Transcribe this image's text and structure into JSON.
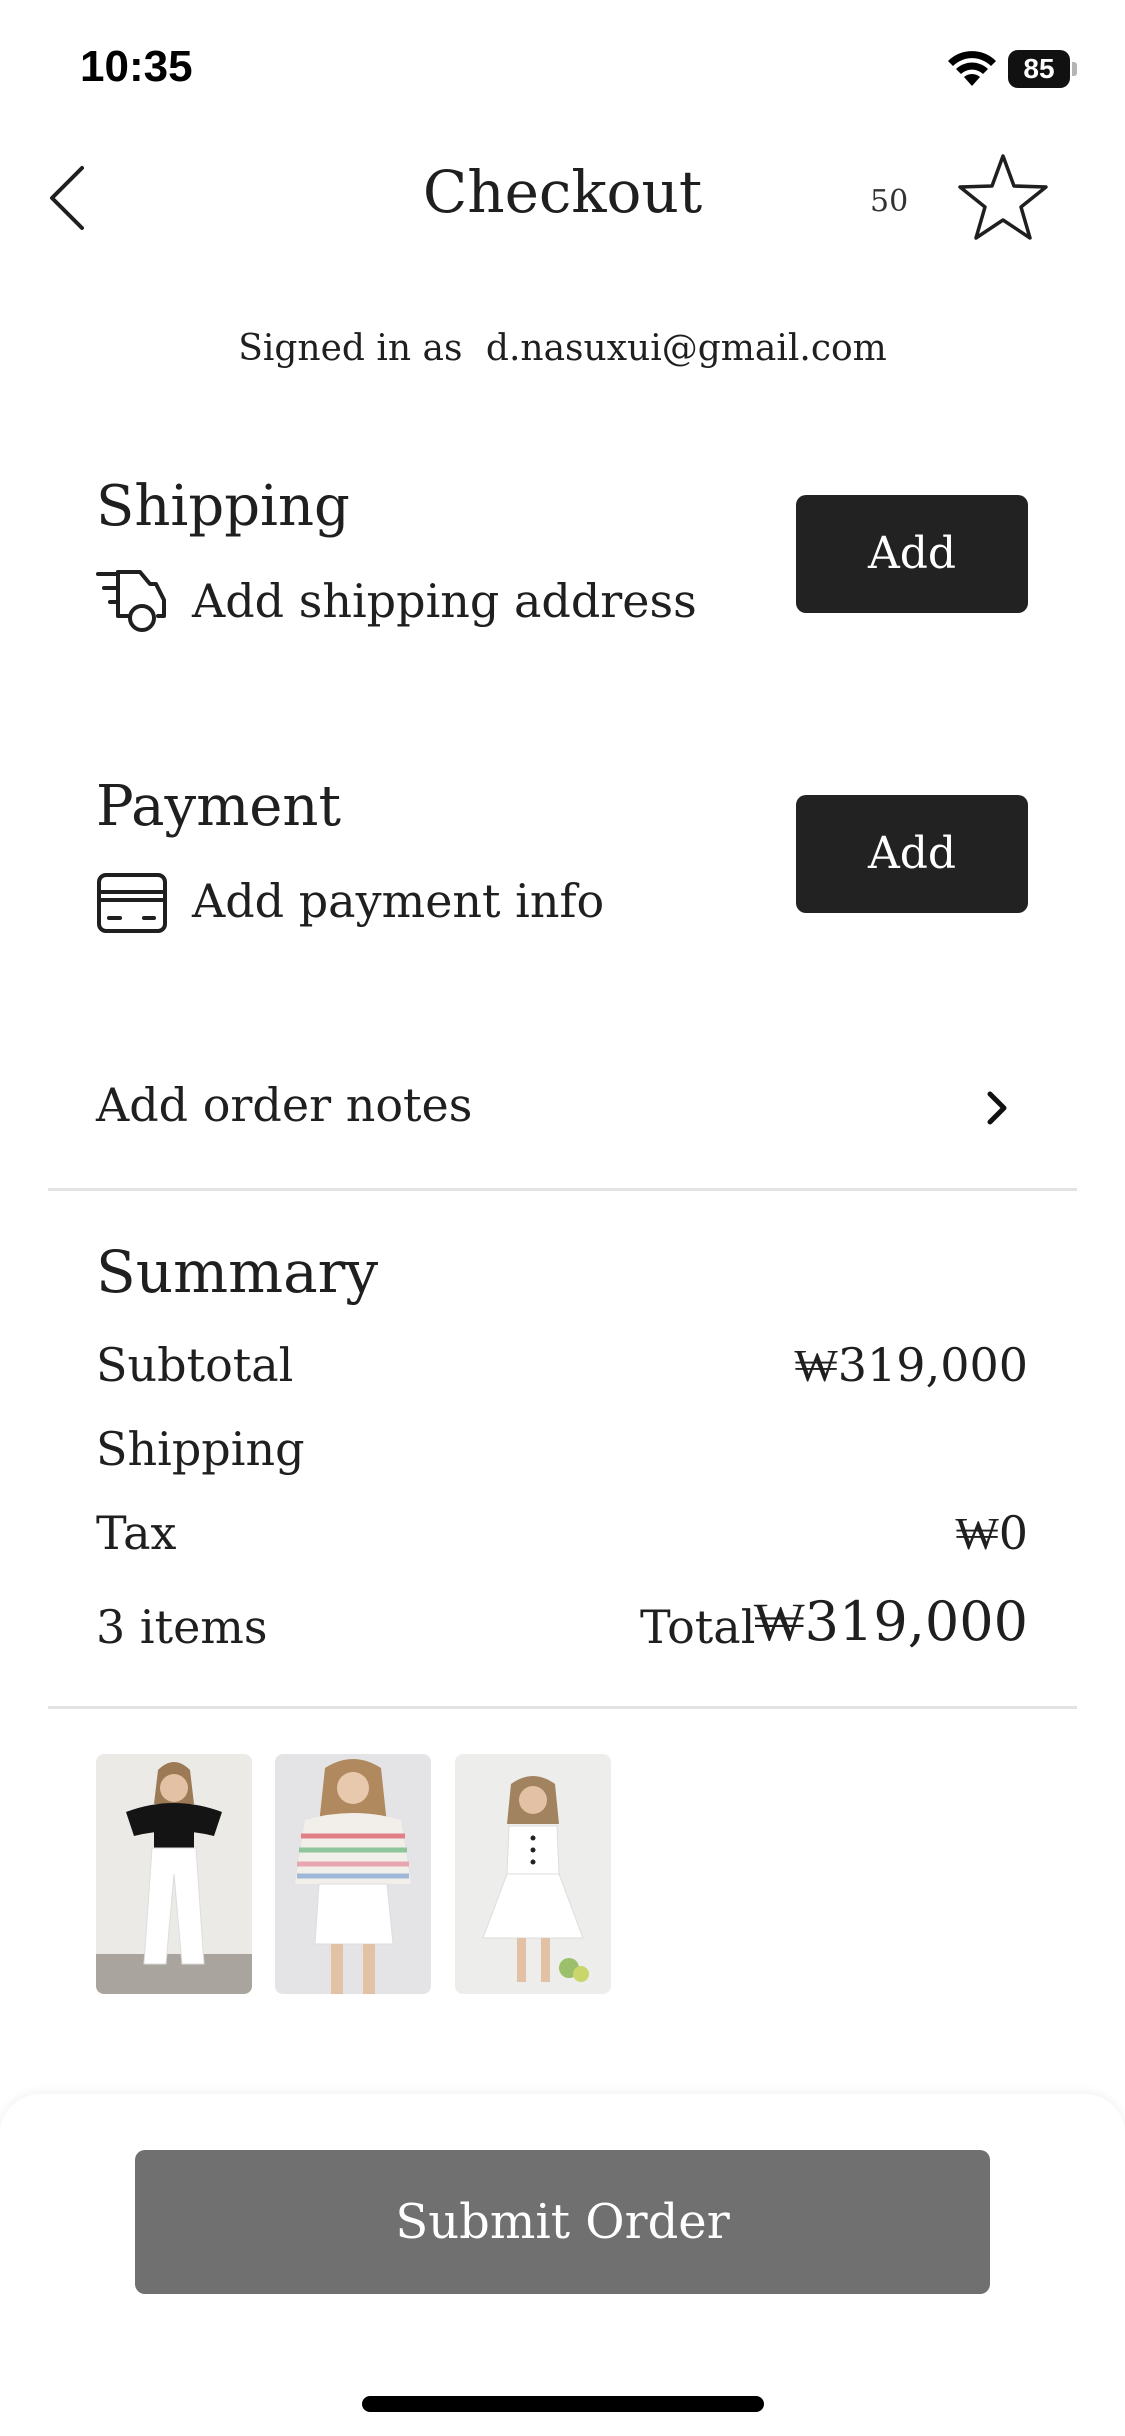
{
  "status_bar": {
    "time": "10:35",
    "battery": "85"
  },
  "header": {
    "title": "Checkout",
    "favorites_count": "50"
  },
  "account": {
    "signed_in_label": "Signed in as",
    "email": "d.nasuxui@gmail.com"
  },
  "shipping": {
    "title": "Shipping",
    "subtitle": "Add shipping address",
    "button_label": "Add",
    "icon": "delivery-truck-icon"
  },
  "payment": {
    "title": "Payment",
    "subtitle": "Add payment info",
    "button_label": "Add",
    "icon": "credit-card-icon"
  },
  "order_notes": {
    "label": "Add order notes"
  },
  "summary": {
    "title": "Summary",
    "subtotal_label": "Subtotal",
    "subtotal_value": "₩319,000",
    "shipping_label": "Shipping",
    "tax_label": "Tax",
    "tax_value": "₩0",
    "items_count": "3 items",
    "total_label": "Total",
    "total_value": "₩319,000"
  },
  "products": [
    {
      "name": "product-thumb-1"
    },
    {
      "name": "product-thumb-2"
    },
    {
      "name": "product-thumb-3"
    }
  ],
  "footer": {
    "submit_label": "Submit Order"
  }
}
